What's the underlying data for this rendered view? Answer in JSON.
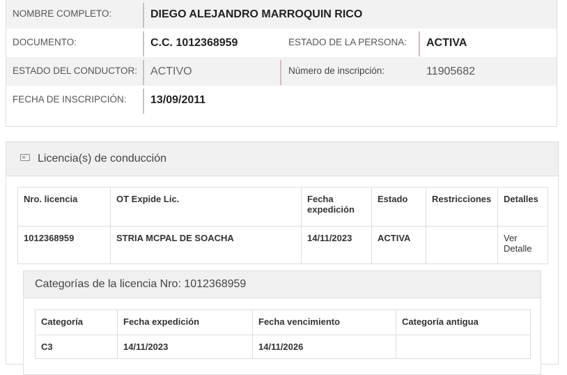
{
  "person": {
    "nombre_label": "NOMBRE COMPLETO:",
    "nombre_value": "DIEGO ALEJANDRO MARROQUIN RICO",
    "documento_label": "DOCUMENTO:",
    "documento_value": "C.C. 1012368959",
    "estado_persona_label": "ESTADO DE LA PERSONA:",
    "estado_persona_value": "ACTIVA",
    "estado_conductor_label": "ESTADO DEL CONDUCTOR:",
    "estado_conductor_value": "ACTIVO",
    "inscripcion_num_label": "Número de inscripción:",
    "inscripcion_num_value": "11905682",
    "fecha_inscripcion_label": "FECHA DE INSCRIPCIÓN:",
    "fecha_inscripcion_value": "13/09/2011"
  },
  "licencias": {
    "title": "Licencia(s) de conducción",
    "icon": "id-card-icon",
    "headers": [
      "Nro. licencia",
      "OT Expide Lic.",
      "Fecha expedición",
      "Estado",
      "Restricciones",
      "Detalles"
    ],
    "rows": [
      {
        "nro": "1012368959",
        "ot": "STRIA MCPAL DE SOACHA",
        "fecha": "14/11/2023",
        "estado": "ACTIVA",
        "restricciones": "",
        "detalle": "Ver Detalle"
      }
    ]
  },
  "categorias": {
    "title": "Categorías de la licencia Nro: 1012368959",
    "headers": [
      "Categoría",
      "Fecha expedición",
      "Fecha vencimiento",
      "Categoría antigua"
    ],
    "rows": [
      {
        "categoria": "C3",
        "expedicion": "14/11/2023",
        "vencimiento": "14/11/2026",
        "antigua": ""
      }
    ]
  }
}
